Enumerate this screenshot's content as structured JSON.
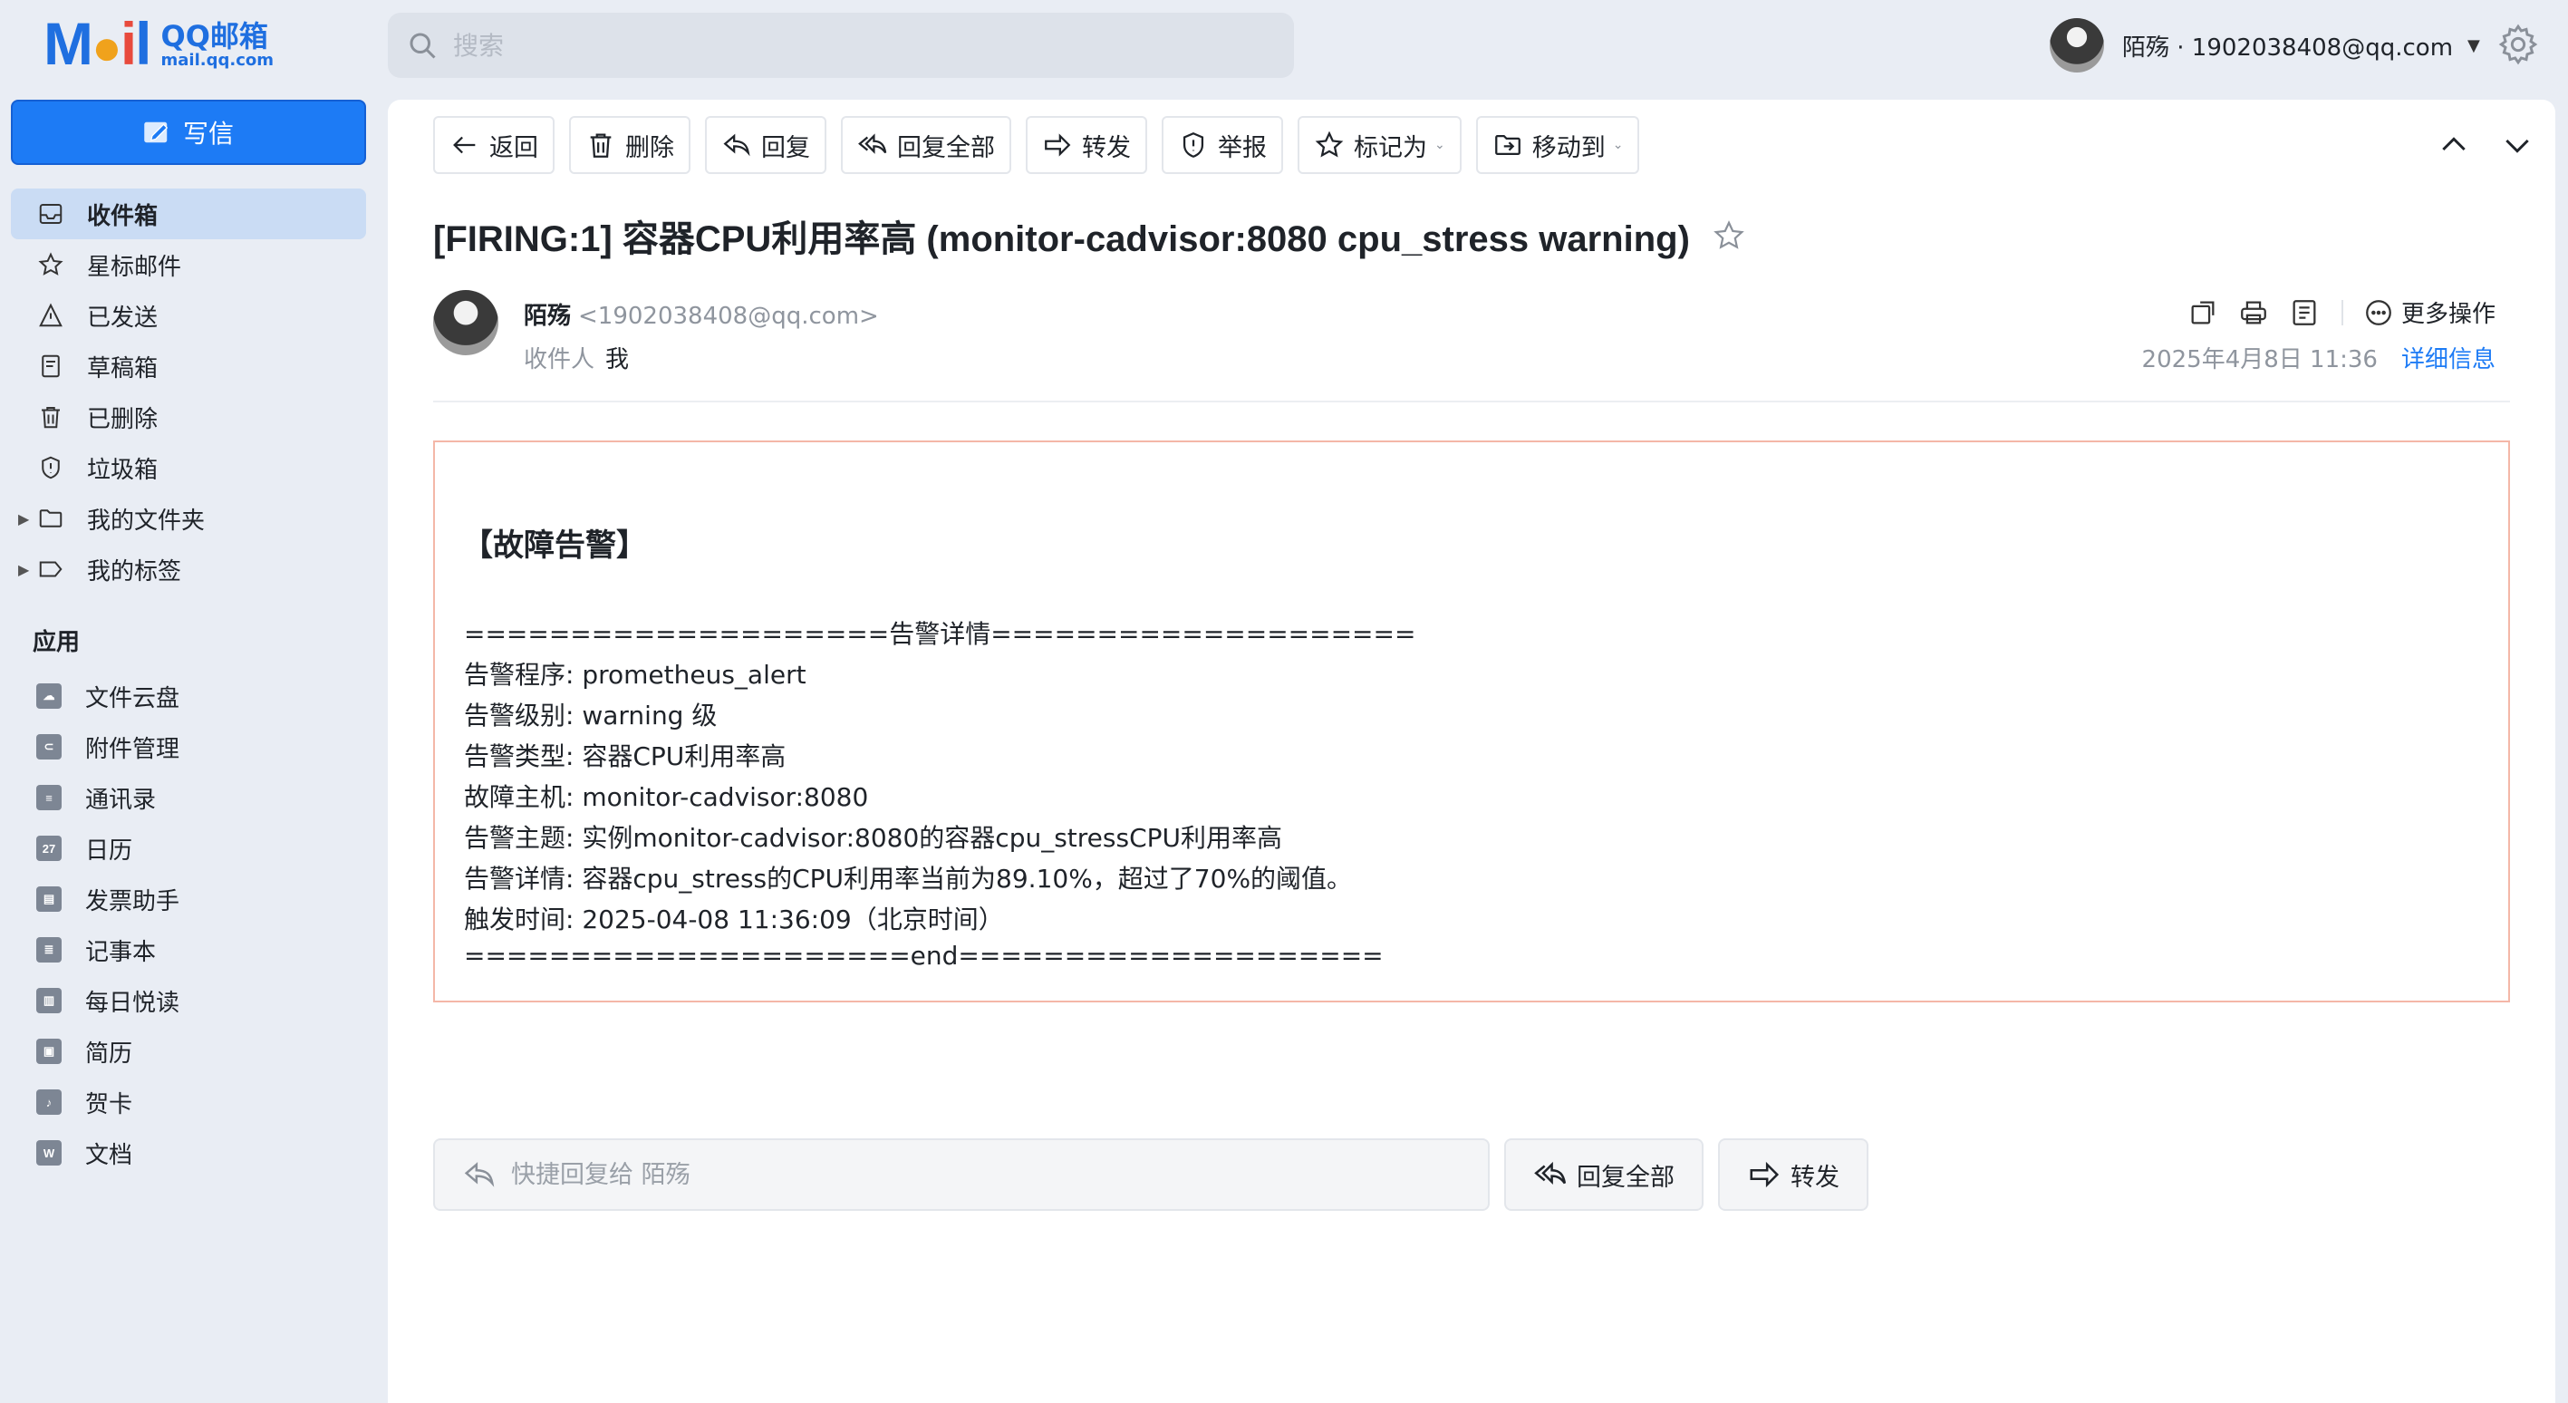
{
  "app": {
    "logo_word": "MAIL",
    "logo_cn": "QQ邮箱",
    "logo_domain": "mail.qq.com",
    "search_placeholder": "搜索",
    "account_name": "陌殇 · 1902038408@qq.com"
  },
  "sidebar": {
    "compose_label": "写信",
    "items": [
      {
        "label": "收件箱",
        "icon": "inbox-icon",
        "active": true
      },
      {
        "label": "星标邮件",
        "icon": "star-icon"
      },
      {
        "label": "已发送",
        "icon": "sent-icon"
      },
      {
        "label": "草稿箱",
        "icon": "draft-icon"
      },
      {
        "label": "已删除",
        "icon": "trash-icon"
      },
      {
        "label": "垃圾箱",
        "icon": "spam-shield-icon"
      },
      {
        "label": "我的文件夹",
        "icon": "folder-icon",
        "expandable": true
      },
      {
        "label": "我的标签",
        "icon": "tag-icon",
        "expandable": true
      }
    ],
    "apps_title": "应用",
    "apps": [
      {
        "label": "文件云盘",
        "icon": "cloud-drive-icon"
      },
      {
        "label": "附件管理",
        "icon": "attachment-icon"
      },
      {
        "label": "通讯录",
        "icon": "contacts-icon"
      },
      {
        "label": "日历",
        "icon": "calendar-icon",
        "badge": "27"
      },
      {
        "label": "发票助手",
        "icon": "invoice-icon"
      },
      {
        "label": "记事本",
        "icon": "notepad-icon"
      },
      {
        "label": "每日悦读",
        "icon": "reading-icon"
      },
      {
        "label": "简历",
        "icon": "resume-icon"
      },
      {
        "label": "贺卡",
        "icon": "greeting-card-icon"
      },
      {
        "label": "文档",
        "icon": "document-icon",
        "badge": "W"
      }
    ]
  },
  "toolbar": {
    "back": "返回",
    "delete": "删除",
    "reply": "回复",
    "reply_all": "回复全部",
    "forward": "转发",
    "report": "举报",
    "mark_as": "标记为",
    "move_to": "移动到"
  },
  "email": {
    "subject": "[FIRING:1] 容器CPU利用率高 (monitor-cadvisor:8080 cpu_stress warning)",
    "sender_name": "陌殇",
    "sender_email": "<1902038408@qq.com>",
    "recipient_label": "收件人",
    "recipient": "我",
    "more_actions": "更多操作",
    "date": "2025年4月8日 11:36",
    "details_link": "详细信息",
    "body": {
      "heading": "【故障告警】",
      "lines": [
        "====================告警详情====================",
        "告警程序: prometheus_alert",
        "告警级别: warning 级",
        "告警类型: 容器CPU利用率高",
        "故障主机: monitor-cadvisor:8080",
        "告警主题: 实例monitor-cadvisor:8080的容器cpu_stressCPU利用率高",
        "告警详情: 容器cpu_stress的CPU利用率当前为89.10%，超过了70%的阈值。",
        "触发时间: 2025-04-08 11:36:09（北京时间）",
        "=====================end===================="
      ]
    }
  },
  "quick_reply": {
    "placeholder": "快捷回复给 陌殇",
    "reply_all": "回复全部",
    "forward": "转发"
  },
  "colors": {
    "accent": "#1d7bf5",
    "sidebar_active": "#cadcf4",
    "body_border": "#f4b7a8"
  }
}
